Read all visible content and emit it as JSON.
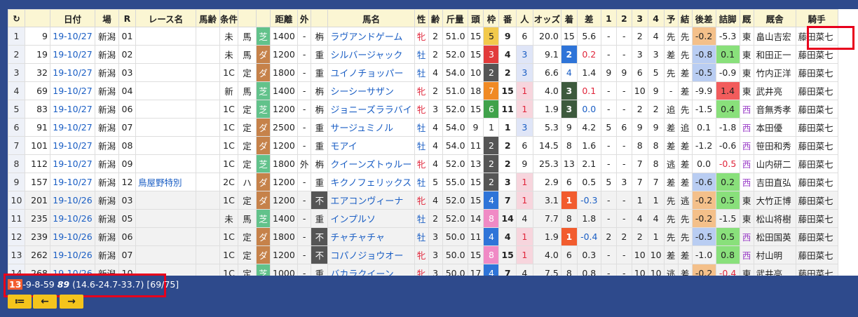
{
  "headers": [
    "↻",
    "",
    "日付",
    "場",
    "R",
    "レース名",
    "馬齢",
    "条件",
    "",
    "",
    "距離",
    "外",
    "",
    "馬名",
    "性",
    "齢",
    "斤量",
    "頭",
    "枠",
    "番",
    "人",
    "オッズ",
    "着",
    "差",
    "1",
    "2",
    "3",
    "4",
    "予",
    "結",
    "後差",
    "詰脚",
    "厩",
    "厩舎",
    "騎手"
  ],
  "rows": [
    [
      "1",
      "9",
      "19-10/27",
      "新潟",
      "01",
      "",
      "",
      "未",
      "馬",
      "芝",
      "1400",
      "-",
      "栴",
      "ラヴアンドゲーム",
      "牝",
      "2",
      "51.0",
      "15",
      "5",
      "9",
      "6",
      "20.0",
      "15",
      "5.6",
      "-",
      "-",
      "2",
      "4",
      "先",
      "先",
      "-0.2",
      "-5.3",
      "東",
      "畠山吉宏",
      "藤田菜七"
    ],
    [
      "2",
      "19",
      "19-10/27",
      "新潟",
      "02",
      "",
      "",
      "未",
      "馬",
      "ダ",
      "1200",
      "-",
      "重",
      "シルバージャック",
      "牡",
      "2",
      "52.0",
      "15",
      "3",
      "4",
      "3",
      "9.1",
      "2",
      "0.2",
      "-",
      "-",
      "3",
      "3",
      "差",
      "先",
      "-0.8",
      "0.1",
      "東",
      "和田正一",
      "藤田菜七"
    ],
    [
      "3",
      "32",
      "19-10/27",
      "新潟",
      "03",
      "",
      "",
      "1C",
      "定",
      "ダ",
      "1800",
      "-",
      "重",
      "ユイノチョッパー",
      "牡",
      "4",
      "54.0",
      "10",
      "2",
      "2",
      "3",
      "6.6",
      "4",
      "1.4",
      "9",
      "9",
      "6",
      "5",
      "先",
      "差",
      "-0.5",
      "-0.9",
      "東",
      "竹内正洋",
      "藤田菜七"
    ],
    [
      "4",
      "69",
      "19-10/27",
      "新潟",
      "04",
      "",
      "",
      "新",
      "馬",
      "芝",
      "1400",
      "-",
      "栴",
      "シーシーサザン",
      "牝",
      "2",
      "51.0",
      "18",
      "7",
      "15",
      "1",
      "4.0",
      "3",
      "0.1",
      "-",
      "-",
      "10",
      "9",
      "-",
      "差",
      "-9.9",
      "1.4",
      "東",
      "武井亮",
      "藤田菜七"
    ],
    [
      "5",
      "83",
      "19-10/27",
      "新潟",
      "06",
      "",
      "",
      "1C",
      "定",
      "芝",
      "1200",
      "-",
      "栴",
      "ジョニーズララバイ",
      "牝",
      "3",
      "52.0",
      "15",
      "6",
      "11",
      "1",
      "1.9",
      "3",
      "0.0",
      "-",
      "-",
      "2",
      "2",
      "追",
      "先",
      "-1.5",
      "0.4",
      "西",
      "音無秀孝",
      "藤田菜七"
    ],
    [
      "6",
      "91",
      "19-10/27",
      "新潟",
      "07",
      "",
      "",
      "1C",
      "定",
      "ダ",
      "2500",
      "-",
      "重",
      "サージュミノル",
      "牡",
      "4",
      "54.0",
      "9",
      "1",
      "1",
      "3",
      "5.3",
      "9",
      "4.2",
      "5",
      "6",
      "9",
      "9",
      "差",
      "追",
      "0.1",
      "-1.8",
      "西",
      "本田優",
      "藤田菜七"
    ],
    [
      "7",
      "101",
      "19-10/27",
      "新潟",
      "08",
      "",
      "",
      "1C",
      "定",
      "ダ",
      "1200",
      "-",
      "重",
      "モアイ",
      "牡",
      "4",
      "54.0",
      "11",
      "2",
      "2",
      "6",
      "14.5",
      "8",
      "1.6",
      "-",
      "-",
      "8",
      "8",
      "差",
      "差",
      "-1.2",
      "-0.6",
      "西",
      "笹田和秀",
      "藤田菜七"
    ],
    [
      "8",
      "112",
      "19-10/27",
      "新潟",
      "09",
      "",
      "",
      "1C",
      "定",
      "芝",
      "1800",
      "外",
      "栴",
      "クイーンズトゥルー",
      "牝",
      "4",
      "52.0",
      "13",
      "2",
      "2",
      "9",
      "25.3",
      "13",
      "2.1",
      "-",
      "-",
      "7",
      "8",
      "逃",
      "差",
      "0.0",
      "-0.5",
      "西",
      "山内研二",
      "藤田菜七"
    ],
    [
      "9",
      "157",
      "19-10/27",
      "新潟",
      "12",
      "鳥屋野特別",
      "",
      "2C",
      "ハ",
      "ダ",
      "1200",
      "-",
      "重",
      "キクノフェリックス",
      "牡",
      "5",
      "55.0",
      "15",
      "2",
      "3",
      "1",
      "2.9",
      "6",
      "0.5",
      "5",
      "3",
      "7",
      "7",
      "差",
      "差",
      "-0.6",
      "0.2",
      "西",
      "吉田直弘",
      "藤田菜七"
    ],
    [
      "10",
      "201",
      "19-10/26",
      "新潟",
      "03",
      "",
      "",
      "1C",
      "定",
      "ダ",
      "1200",
      "-",
      "不",
      "エアコンヴィーナ",
      "牝",
      "4",
      "52.0",
      "15",
      "4",
      "7",
      "1",
      "3.1",
      "1",
      "-0.3",
      "-",
      "-",
      "1",
      "1",
      "先",
      "逃",
      "-0.2",
      "0.5",
      "東",
      "大竹正博",
      "藤田菜七"
    ],
    [
      "11",
      "235",
      "19-10/26",
      "新潟",
      "05",
      "",
      "",
      "未",
      "馬",
      "芝",
      "1400",
      "-",
      "重",
      "インプルソ",
      "牡",
      "2",
      "52.0",
      "14",
      "8",
      "14",
      "4",
      "7.7",
      "8",
      "1.8",
      "-",
      "-",
      "4",
      "4",
      "先",
      "先",
      "-0.2",
      "-1.5",
      "東",
      "松山将樹",
      "藤田菜七"
    ],
    [
      "12",
      "239",
      "19-10/26",
      "新潟",
      "06",
      "",
      "",
      "1C",
      "定",
      "ダ",
      "1800",
      "-",
      "不",
      "チャチャチャ",
      "牡",
      "3",
      "50.0",
      "11",
      "4",
      "4",
      "1",
      "1.9",
      "1",
      "-0.4",
      "2",
      "2",
      "2",
      "1",
      "先",
      "先",
      "-0.5",
      "0.5",
      "西",
      "松田国英",
      "藤田菜七"
    ],
    [
      "13",
      "262",
      "19-10/26",
      "新潟",
      "07",
      "",
      "",
      "1C",
      "定",
      "ダ",
      "1200",
      "-",
      "不",
      "コパノジョウオー",
      "牝",
      "3",
      "50.0",
      "15",
      "8",
      "15",
      "1",
      "4.0",
      "6",
      "0.3",
      "-",
      "-",
      "10",
      "10",
      "差",
      "差",
      "-1.0",
      "0.8",
      "西",
      "村山明",
      "藤田菜七"
    ],
    [
      "14",
      "268",
      "19-10/26",
      "新潟",
      "10",
      "",
      "",
      "1C",
      "定",
      "芝",
      "1000",
      "-",
      "重",
      "バカラクイーン",
      "牝",
      "3",
      "50.0",
      "17",
      "4",
      "7",
      "4",
      "7.5",
      "8",
      "0.8",
      "-",
      "-",
      "10",
      "10",
      "逃",
      "差",
      "-0.2",
      "-0.4",
      "東",
      "武井亮",
      "藤田菜七"
    ]
  ],
  "status": {
    "num": "13",
    "counts": "-9-8-59",
    "score": "89",
    "detail": "(14.6-24.7-33.7) [69/75]"
  },
  "buttons": {
    "list": "≔",
    "prev": "←",
    "next": "→"
  },
  "colors": {
    "accent": "#f4c41c",
    "frame": "#e8001c",
    "background": "#2e4a8c"
  }
}
